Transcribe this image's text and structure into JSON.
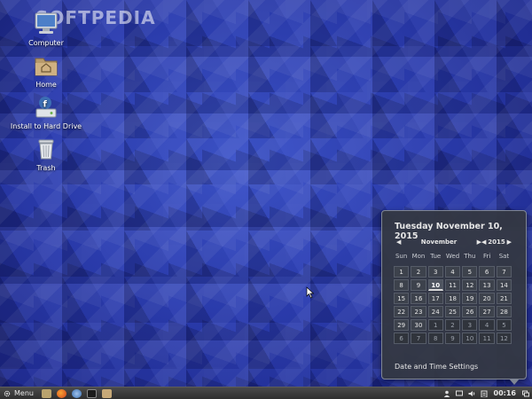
{
  "watermark": "SOFTPEDIA",
  "desktop": {
    "icons": [
      {
        "label": "Computer",
        "icon": "computer-icon"
      },
      {
        "label": "Home",
        "icon": "home-folder-icon"
      },
      {
        "label": "Install to Hard Drive",
        "icon": "installer-icon"
      },
      {
        "label": "Trash",
        "icon": "trash-icon"
      }
    ]
  },
  "panel": {
    "menu_label": "Menu",
    "launchers": [
      "files-icon",
      "firefox-icon",
      "tracker-icon",
      "terminal-icon",
      "folder-icon"
    ],
    "tray": [
      "user-icon",
      "screen-icon",
      "volume-icon",
      "clipboard-icon"
    ],
    "clock": "00:16",
    "end_icon": "workspace-icon"
  },
  "calendar": {
    "title": "Tuesday November 10, 2015",
    "month": "November",
    "year": "2015",
    "weekdays": [
      "Sun",
      "Mon",
      "Tue",
      "Wed",
      "Thu",
      "Fri",
      "Sat"
    ],
    "weeks": [
      [
        "1",
        "2",
        "3",
        "4",
        "5",
        "6",
        "7"
      ],
      [
        "8",
        "9",
        "10",
        "11",
        "12",
        "13",
        "14"
      ],
      [
        "15",
        "16",
        "17",
        "18",
        "19",
        "20",
        "21"
      ],
      [
        "22",
        "23",
        "24",
        "25",
        "26",
        "27",
        "28"
      ],
      [
        "29",
        "30",
        "1",
        "2",
        "3",
        "4",
        "5"
      ],
      [
        "6",
        "7",
        "8",
        "9",
        "10",
        "11",
        "12"
      ]
    ],
    "today": "10",
    "settings_label": "Date and Time Settings"
  },
  "colors": {
    "desktop_blue": "#2a3bab",
    "panel_bg": "#3a3a3a",
    "popup_bg": "#343842"
  }
}
